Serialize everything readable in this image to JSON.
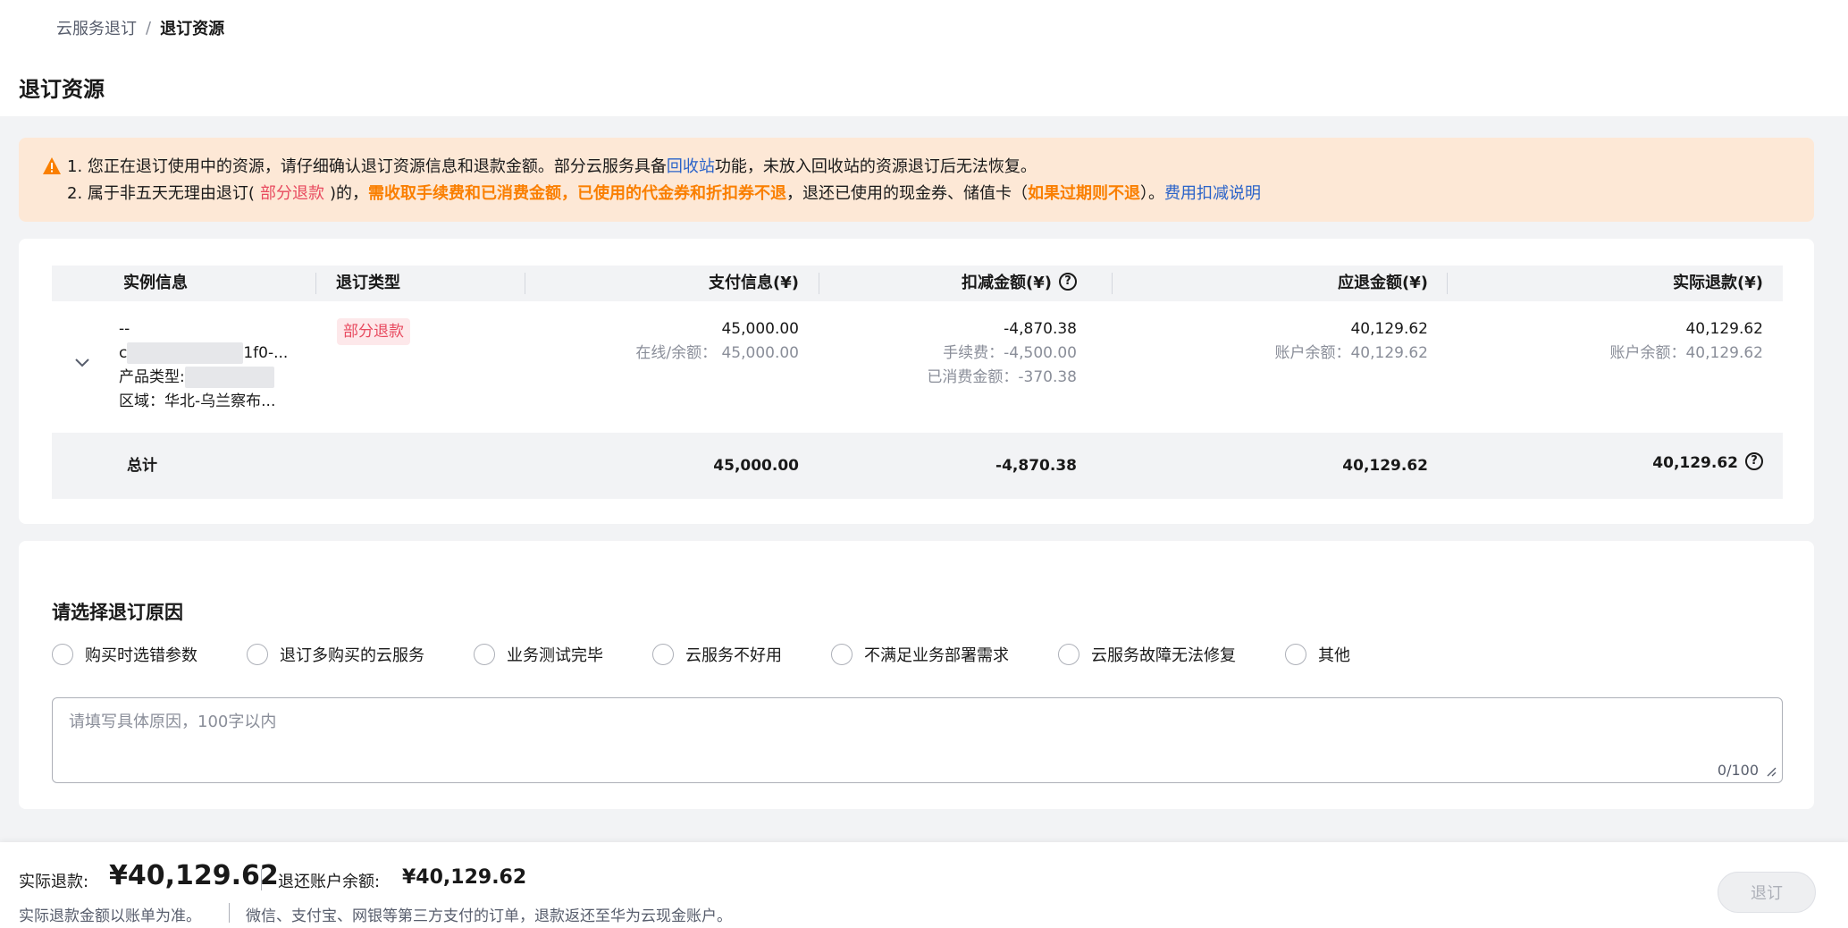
{
  "breadcrumb": {
    "root": "云服务退订",
    "separator": "/",
    "current": "退订资源"
  },
  "page_title": "退订资源",
  "alert": {
    "line1_num": "1.",
    "line1_text": "您正在退订使用中的资源，请仔细确认退订资源信息和退款金额。部分云服务具备",
    "line1_link": "回收站",
    "line1_tail": "功能，未放入回收站的资源退订后无法恢复。",
    "line2_num": "2.",
    "line2_pre": "属于非五天无理由退订(",
    "line2_tag": "部分退款",
    "line2_mid": ")的，",
    "line2_bold": "需收取手续费和已消费金额，已使用的代金券和折扣券不退",
    "line2_after": "，退还已使用的现金券、储值卡（",
    "line2_bold2": "如果过期则不退",
    "line2_end": "）。",
    "line2_link": "费用扣减说明"
  },
  "table": {
    "headers": {
      "instance": "实例信息",
      "type": "退订类型",
      "payment": "支付信息(¥)",
      "deduction": "扣减金额(¥)",
      "due": "应退金额(¥)",
      "actual": "实际退款(¥)"
    },
    "row": {
      "name": "--",
      "id_prefix": "c",
      "id_suffix": "1f0-...",
      "product_type_label": "产品类型:",
      "region": "区域：华北-乌兰察布...",
      "type_tag": "部分退款",
      "payment": "45,000.00",
      "payment_sub": "在线/余额：  45,000.00",
      "deduction": "-4,870.38",
      "deduction_fee": "手续费：-4,500.00",
      "deduction_consumed": "已消费金额：-370.38",
      "due": "40,129.62",
      "due_sub": "账户余额：40,129.62",
      "actual": "40,129.62",
      "actual_sub": "账户余额：40,129.62"
    },
    "total": {
      "label": "总计",
      "payment": "45,000.00",
      "deduction": "-4,870.38",
      "due": "40,129.62",
      "actual": "40,129.62"
    }
  },
  "reason": {
    "title": "请选择退订原因",
    "options": [
      "购买时选错参数",
      "退订多购买的云服务",
      "业务测试完毕",
      "云服务不好用",
      "不满足业务部署需求",
      "云服务故障无法修复",
      "其他"
    ],
    "placeholder": "请填写具体原因，100字以内",
    "counter": "0/100"
  },
  "footer": {
    "actual_label": "实际退款:",
    "actual_amount": "¥40,129.62",
    "balance_label": "退还账户余额:",
    "balance_amount": "¥40,129.62",
    "note1": "实际退款金额以账单为准。",
    "note2": "微信、支付宝、网银等第三方支付的订单，退款返还至华为云现金账户。",
    "submit": "退订"
  },
  "colors": {
    "link": "#2a63c9",
    "warning": "#fa7f00",
    "tag": "#e84a5f",
    "alert_bg": "#fde8d6"
  }
}
